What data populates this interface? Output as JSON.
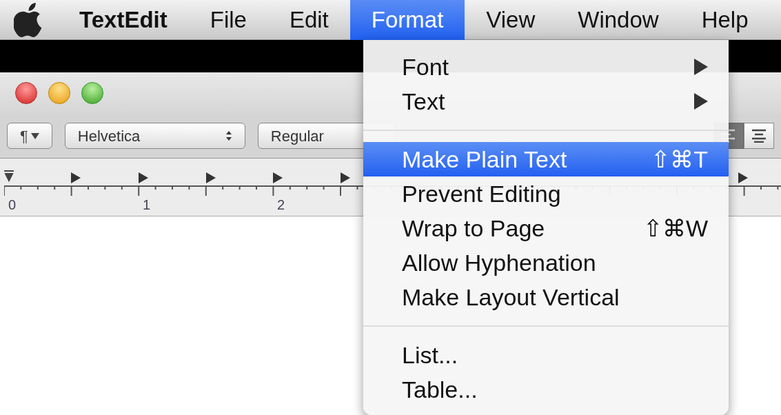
{
  "menubar": {
    "items": [
      {
        "label": "TextEdit",
        "selected": false,
        "kind": "app"
      },
      {
        "label": "File",
        "selected": false,
        "kind": "menu"
      },
      {
        "label": "Edit",
        "selected": false,
        "kind": "menu"
      },
      {
        "label": "Format",
        "selected": true,
        "kind": "menu"
      },
      {
        "label": "View",
        "selected": false,
        "kind": "menu"
      },
      {
        "label": "Window",
        "selected": false,
        "kind": "menu"
      },
      {
        "label": "Help",
        "selected": false,
        "kind": "menu"
      }
    ]
  },
  "toolbar": {
    "paragraph_button": "¶",
    "font_family": "Helvetica",
    "typeface": "Regular"
  },
  "ruler": {
    "labels": [
      "0",
      "1",
      "2"
    ]
  },
  "format_menu": {
    "sections": [
      [
        {
          "label": "Font",
          "kind": "submenu",
          "selected": false
        },
        {
          "label": "Text",
          "kind": "submenu",
          "selected": false
        }
      ],
      [
        {
          "label": "Make Plain Text",
          "kind": "command",
          "shortcut": "⇧⌘T",
          "selected": true
        },
        {
          "label": "Prevent Editing",
          "kind": "command",
          "selected": false
        },
        {
          "label": "Wrap to Page",
          "kind": "command",
          "shortcut": "⇧⌘W",
          "selected": false
        },
        {
          "label": "Allow Hyphenation",
          "kind": "command",
          "selected": false
        },
        {
          "label": "Make Layout Vertical",
          "kind": "command",
          "selected": false
        }
      ],
      [
        {
          "label": "List...",
          "kind": "command",
          "selected": false
        },
        {
          "label": "Table...",
          "kind": "command",
          "selected": false
        }
      ]
    ]
  }
}
